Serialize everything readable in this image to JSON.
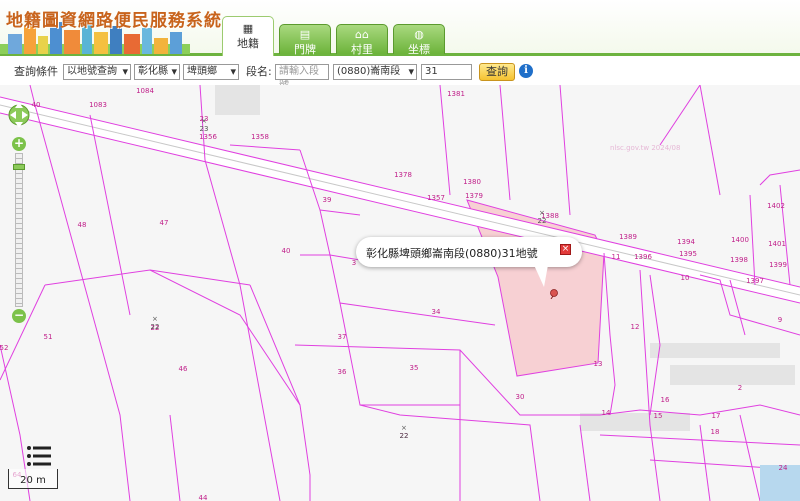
{
  "header": {
    "title": "地籍圖資網路便民服務系統",
    "tabs": [
      {
        "label": "地籍",
        "icon": "map-icon",
        "active": true
      },
      {
        "label": "門牌",
        "icon": "house-number-icon",
        "active": false
      },
      {
        "label": "村里",
        "icon": "village-icon",
        "active": false
      },
      {
        "label": "坐標",
        "icon": "globe-icon",
        "active": false
      }
    ]
  },
  "query": {
    "condition_label": "查詢條件",
    "mode_value": "以地號查詢",
    "county_value": "彰化縣",
    "town_value": "埤頭鄉",
    "section_label": "段名:",
    "section_placeholder": "請輸入段號",
    "section_select_value": "(0880)崙南段",
    "parcel_number": "31",
    "query_button": "查詢",
    "info_icon": "i"
  },
  "map": {
    "watermark": "nlsc.gov.tw 2024/08",
    "popup_text": "彰化縣埤頭鄉崙南段(0880)31地號",
    "popup_close": "×",
    "scale_label": "20 m",
    "highlight_color": "#f7d0d3",
    "parcel_line_color": "#e040e0",
    "parcel_labels": [
      "1084",
      "1083",
      "40",
      "23",
      "1356",
      "1358",
      "1381",
      "1378",
      "39",
      "1380",
      "1379",
      "1357",
      "1388",
      "48",
      "47",
      "40",
      "1389",
      "1394",
      "1400",
      "1402",
      "1401",
      "1395",
      "1396",
      "1398",
      "1399",
      "11",
      "10",
      "1397",
      "3",
      "34",
      "12",
      "9",
      "37",
      "51",
      "52",
      "22",
      "46",
      "36",
      "35",
      "13",
      "2",
      "30",
      "16",
      "14",
      "15",
      "17",
      "18",
      "22",
      "24",
      "44",
      "64"
    ],
    "point_labels": [
      "23",
      "22",
      "22",
      "22"
    ],
    "zoom_in": "+",
    "zoom_out": "−"
  }
}
